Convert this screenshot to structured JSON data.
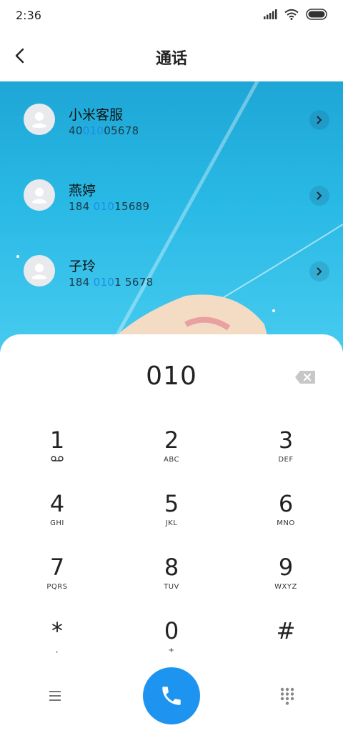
{
  "status_bar": {
    "time": "2:36"
  },
  "header": {
    "title": "通话"
  },
  "contacts": [
    {
      "name": "小米客服",
      "phone_pre": "40",
      "phone_hl": "010",
      "phone_post": "05678"
    },
    {
      "name": "燕婷",
      "phone_pre": "184 ",
      "phone_hl": "010",
      "phone_post": "15689"
    },
    {
      "name": "子玲",
      "phone_pre": "184 ",
      "phone_hl": "010",
      "phone_post": "1 5678"
    }
  ],
  "dialer": {
    "number": "010",
    "keys": [
      {
        "digit": "1",
        "letters": ""
      },
      {
        "digit": "2",
        "letters": "ABC"
      },
      {
        "digit": "3",
        "letters": "DEF"
      },
      {
        "digit": "4",
        "letters": "GHI"
      },
      {
        "digit": "5",
        "letters": "JKL"
      },
      {
        "digit": "6",
        "letters": "MNO"
      },
      {
        "digit": "7",
        "letters": "PQRS"
      },
      {
        "digit": "8",
        "letters": "TUV"
      },
      {
        "digit": "9",
        "letters": "WXYZ"
      },
      {
        "digit": "*",
        "letters": ","
      },
      {
        "digit": "0",
        "letters": "+"
      },
      {
        "digit": "#",
        "letters": ""
      }
    ]
  },
  "colors": {
    "accent": "#1d94f0",
    "highlight": "#1a8ee8"
  },
  "icons": {
    "back": "chevron-left-icon",
    "delete": "backspace-icon",
    "menu": "menu-icon",
    "call": "phone-icon",
    "keypad": "dialpad-icon"
  }
}
